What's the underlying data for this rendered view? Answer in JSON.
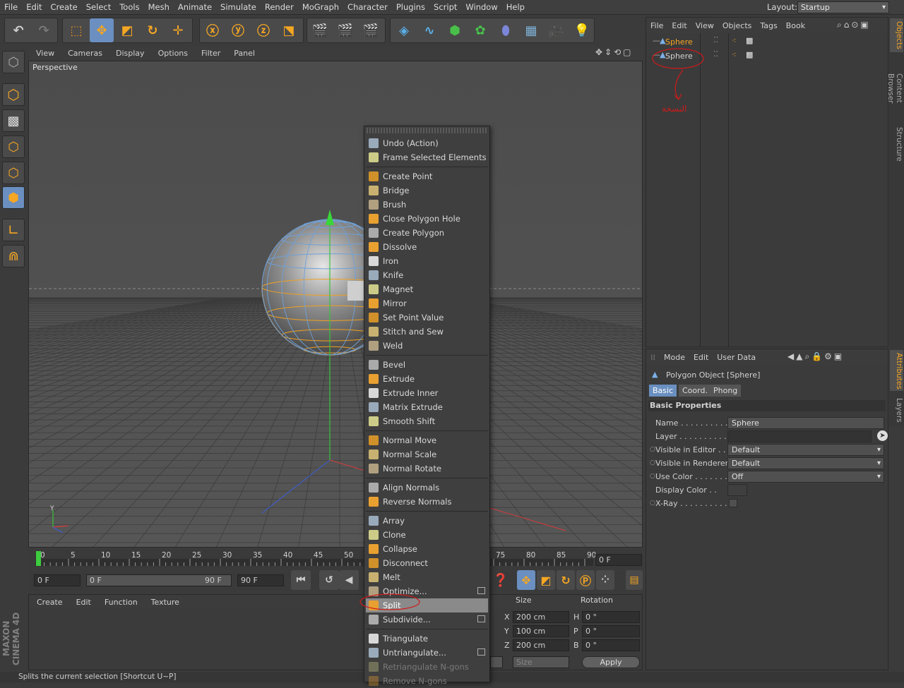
{
  "menubar": {
    "items": [
      "File",
      "Edit",
      "Create",
      "Select",
      "Tools",
      "Mesh",
      "Animate",
      "Simulate",
      "Render",
      "MoGraph",
      "Character",
      "Plugins",
      "Script",
      "Window",
      "Help"
    ],
    "layout_label": "Layout:",
    "layout_value": "Startup"
  },
  "viewport": {
    "menu": [
      "View",
      "Cameras",
      "Display",
      "Options",
      "Filter",
      "Panel"
    ],
    "label": "Perspective",
    "axis_y": "Y"
  },
  "timeline": {
    "ticks": [
      "0",
      "5",
      "10",
      "15",
      "20",
      "25",
      "30",
      "35",
      "40",
      "45",
      "50",
      "75",
      "80",
      "85",
      "90"
    ],
    "frame_field": "0 F"
  },
  "transport": {
    "start": "0 F",
    "range_start": "0 F",
    "range_end": "90 F",
    "end": "90 F"
  },
  "material": {
    "menu": [
      "Create",
      "Edit",
      "Function",
      "Texture"
    ]
  },
  "coord": {
    "size_header": "Size",
    "rotation_header": "Rotation",
    "rows": [
      {
        "axis": "X",
        "size": "200 cm",
        "rot_axis": "H",
        "rot": "0 °"
      },
      {
        "axis": "Y",
        "size": "100 cm",
        "rot_axis": "P",
        "rot": "0 °"
      },
      {
        "axis": "Z",
        "size": "200 cm",
        "rot_axis": "B",
        "rot": "0 °"
      }
    ],
    "size_mode": "Size",
    "apply": "Apply"
  },
  "objects": {
    "menu": [
      "File",
      "Edit",
      "View",
      "Objects",
      "Tags",
      "Book"
    ],
    "rows": [
      {
        "name": "Sphere"
      },
      {
        "name": "Sphere"
      }
    ],
    "annotation": "النسخة"
  },
  "side_tabs": [
    "Objects",
    "Content Browser",
    "Structure",
    "Attributes",
    "Layers"
  ],
  "attributes": {
    "menu": [
      "Mode",
      "Edit",
      "User Data"
    ],
    "object_title": "Polygon Object [Sphere]",
    "tabs": [
      "Basic",
      "Coord.",
      "Phong"
    ],
    "section": "Basic Properties",
    "props": [
      {
        "label": "Name . . . . . . . . . . .",
        "value": "Sphere"
      },
      {
        "label": "Layer . . . . . . . . . . .",
        "value": ""
      },
      {
        "label": "Visible in Editor . .",
        "value": "Default"
      },
      {
        "label": "Visible in Renderer",
        "value": "Default"
      },
      {
        "label": "Use Color . . . . . . .",
        "value": "Off"
      },
      {
        "label": "Display Color . .",
        "value": ""
      },
      {
        "label": "X-Ray . . . . . . . . . .",
        "value": ""
      }
    ]
  },
  "context_menu": {
    "items": [
      {
        "label": "Undo (Action)"
      },
      {
        "label": "Frame Selected Elements"
      },
      {
        "sep": true
      },
      {
        "label": "Create Point"
      },
      {
        "label": "Bridge"
      },
      {
        "label": "Brush"
      },
      {
        "label": "Close Polygon Hole"
      },
      {
        "label": "Create Polygon"
      },
      {
        "label": "Dissolve"
      },
      {
        "label": "Iron"
      },
      {
        "label": "Knife"
      },
      {
        "label": "Magnet"
      },
      {
        "label": "Mirror"
      },
      {
        "label": "Set Point Value"
      },
      {
        "label": "Stitch and Sew"
      },
      {
        "label": "Weld"
      },
      {
        "sep": true
      },
      {
        "label": "Bevel"
      },
      {
        "label": "Extrude"
      },
      {
        "label": "Extrude Inner"
      },
      {
        "label": "Matrix Extrude"
      },
      {
        "label": "Smooth Shift"
      },
      {
        "sep": true
      },
      {
        "label": "Normal Move"
      },
      {
        "label": "Normal Scale"
      },
      {
        "label": "Normal Rotate"
      },
      {
        "sep": true
      },
      {
        "label": "Align Normals"
      },
      {
        "label": "Reverse Normals"
      },
      {
        "sep": true
      },
      {
        "label": "Array"
      },
      {
        "label": "Clone"
      },
      {
        "label": "Collapse"
      },
      {
        "label": "Disconnect"
      },
      {
        "label": "Melt"
      },
      {
        "label": "Optimize..."
      },
      {
        "label": "Split",
        "highlight": true
      },
      {
        "label": "Subdivide..."
      },
      {
        "sep": true
      },
      {
        "label": "Triangulate"
      },
      {
        "label": "Untriangulate..."
      },
      {
        "label": "Retriangulate N-gons",
        "disabled": true
      },
      {
        "label": "Remove N-gons",
        "disabled": true
      }
    ]
  },
  "status": "Splits the current selection [Shortcut U~P]",
  "brand": "MAXON CINEMA 4D"
}
